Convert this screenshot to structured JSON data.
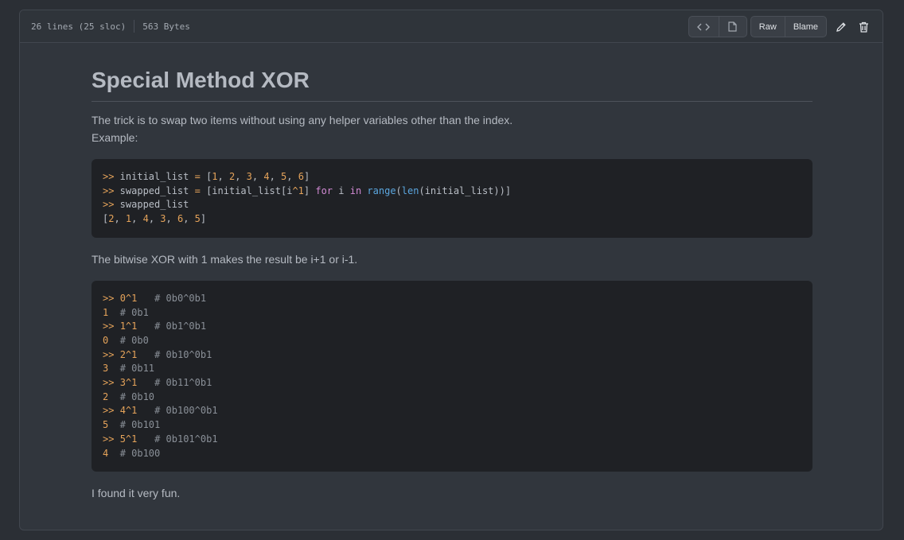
{
  "header": {
    "lines": "26 lines (25 sloc)",
    "size": "563 Bytes",
    "raw_label": "Raw",
    "blame_label": "Blame"
  },
  "article": {
    "title": "Special Method XOR",
    "intro_line1": "The trick is to swap two items without using any helper variables other than the index.",
    "intro_line2": "Example:",
    "middle": "The bitwise XOR with 1 makes the result be i+1 or i-1.",
    "outro": "I found it very fun."
  },
  "code1": [
    ">> initial_list = [1, 2, 3, 4, 5, 6]",
    ">> swapped_list = [initial_list[i^1] for i in range(len(initial_list))]",
    ">> swapped_list",
    "[2, 1, 4, 3, 6, 5]"
  ],
  "code2": [
    ">> 0^1   # 0b0^0b1",
    "1  # 0b1",
    ">> 1^1   # 0b1^0b1",
    "0  # 0b0",
    ">> 2^1   # 0b10^0b1",
    "3  # 0b11",
    ">> 3^1   # 0b11^0b1",
    "2  # 0b10",
    ">> 4^1   # 0b100^0b1",
    "5  # 0b101",
    ">> 5^1   # 0b101^0b1",
    "4  # 0b100"
  ],
  "colors": {
    "accent_orange": "#e5a35a",
    "keyword_purple": "#d28ad4",
    "function_blue": "#5ba7e0"
  }
}
